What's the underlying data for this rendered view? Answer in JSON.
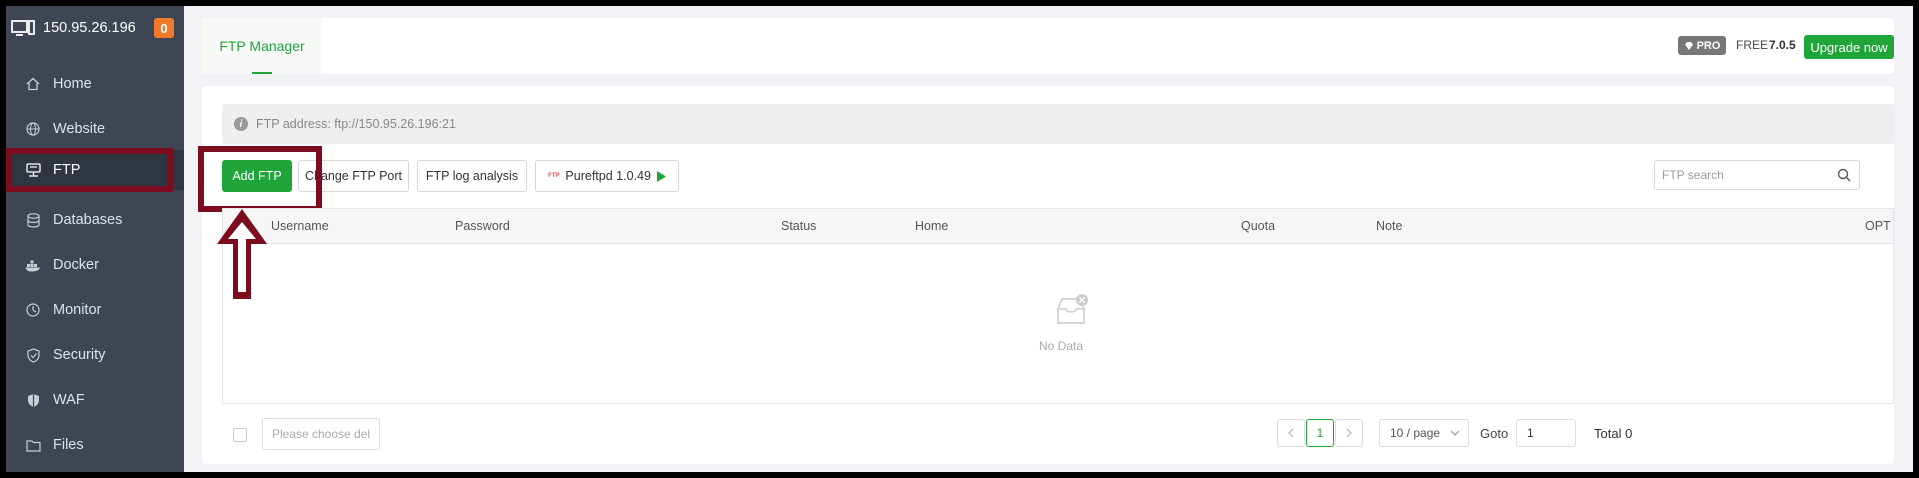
{
  "sidebar": {
    "server": {
      "ip": "150.95.26.196",
      "badge": "0"
    },
    "items": [
      {
        "label": "Home",
        "icon": "home-icon"
      },
      {
        "label": "Website",
        "icon": "globe-icon"
      },
      {
        "label": "FTP",
        "icon": "ftp-icon",
        "active": true
      },
      {
        "label": "Databases",
        "icon": "database-icon"
      },
      {
        "label": "Docker",
        "icon": "docker-icon"
      },
      {
        "label": "Monitor",
        "icon": "monitor-icon"
      },
      {
        "label": "Security",
        "icon": "shield-icon"
      },
      {
        "label": "WAF",
        "icon": "waf-shield-icon"
      },
      {
        "label": "Files",
        "icon": "folder-icon"
      }
    ]
  },
  "header": {
    "tab": "FTP Manager",
    "pro": "PRO",
    "free": "FREE",
    "version": "7.0.5",
    "upgrade": "Upgrade now"
  },
  "main": {
    "info": "FTP address: ftp://150.95.26.196:21",
    "buttons": {
      "add": "Add FTP",
      "change_port": "Change FTP Port",
      "log_analysis": "FTP log analysis",
      "pureftpd": "Pureftpd 1.0.49"
    },
    "search_placeholder": "FTP search",
    "columns": [
      "Username",
      "Password",
      "Status",
      "Home",
      "Quota",
      "Note",
      "OPT"
    ],
    "empty": "No Data",
    "batch_placeholder": "Please choose del",
    "pagination": {
      "current_page": "1",
      "per_page": "10 / page",
      "goto_label": "Goto",
      "goto_value": "1",
      "total": "Total 0"
    }
  },
  "colors": {
    "accent": "#20a53a",
    "sidebar_bg": "#3d4652",
    "highlight": "#7b0d1e",
    "badge": "#f07a2a"
  }
}
